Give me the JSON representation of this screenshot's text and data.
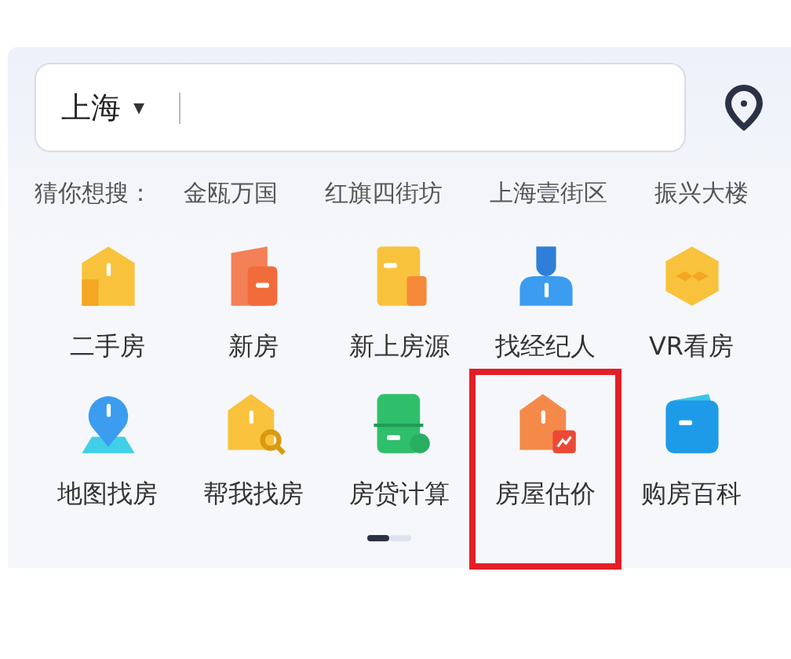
{
  "search": {
    "city": "上海",
    "caret": "▾"
  },
  "suggestions": {
    "label": "猜你想搜：",
    "items": [
      "金瓯万国",
      "红旗四街坊",
      "上海壹街区",
      "振兴大楼"
    ]
  },
  "shortcuts": [
    {
      "label": "二手房",
      "kind": "house",
      "color": "#f9c23c",
      "highlighted": false
    },
    {
      "label": "新房",
      "kind": "building",
      "color": "#f26b3a",
      "highlighted": false
    },
    {
      "label": "新上房源",
      "kind": "door",
      "color": "#f9c23c",
      "highlighted": false
    },
    {
      "label": "找经纪人",
      "kind": "person",
      "color": "#3b9cf0",
      "highlighted": false
    },
    {
      "label": "VR看房",
      "kind": "hexagon",
      "color": "#f9c23c",
      "highlighted": false
    },
    {
      "label": "地图找房",
      "kind": "pin",
      "color": "#3b9cf0",
      "highlighted": false
    },
    {
      "label": "帮我找房",
      "kind": "search-house",
      "color": "#f9c23c",
      "highlighted": false
    },
    {
      "label": "房贷计算",
      "kind": "calculator",
      "color": "#2fbf6a",
      "highlighted": false
    },
    {
      "label": "房屋估价",
      "kind": "price-house",
      "color": "#f5894a",
      "highlighted": true
    },
    {
      "label": "购房百科",
      "kind": "book",
      "color": "#1e9be8",
      "highlighted": false
    }
  ],
  "pages": [
    {
      "selected": true
    },
    {
      "selected": false
    }
  ]
}
